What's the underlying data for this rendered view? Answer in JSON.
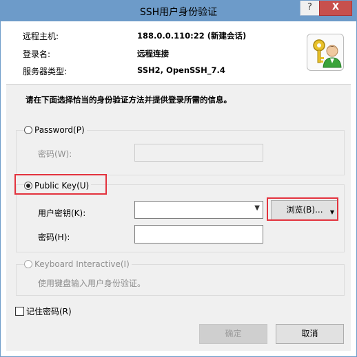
{
  "window": {
    "title": "SSH用户身份验证",
    "help_label": "?",
    "close_label": "X"
  },
  "info": {
    "rows": [
      {
        "label": "远程主机:",
        "value": "188.0.0.110:22 (新建会话)"
      },
      {
        "label": "登录名:",
        "value": "远程连接"
      },
      {
        "label": "服务器类型:",
        "value": "SSH2, OpenSSH_7.4"
      }
    ],
    "icon": "key-user-icon"
  },
  "instruction": "请在下面选择恰当的身份验证方法并提供登录所需的信息。",
  "password_group": {
    "radio_label": "Password(P)",
    "selected": false,
    "password_label": "密码(W):",
    "password_value": ""
  },
  "publickey_group": {
    "radio_label": "Public Key(U)",
    "selected": true,
    "user_key_label": "用户密钥(K):",
    "user_key_value": "",
    "browse_label": "浏览(B)...",
    "passphrase_label": "密码(H):",
    "passphrase_value": ""
  },
  "keyboard_group": {
    "radio_label": "Keyboard Interactive(I)",
    "selected": false,
    "description": "使用键盘输入用户身份验证。"
  },
  "remember": {
    "label": "记住密码(R)",
    "checked": false
  },
  "buttons": {
    "ok_label": "确定",
    "cancel_label": "取消"
  },
  "highlight_color": "#e3323d"
}
